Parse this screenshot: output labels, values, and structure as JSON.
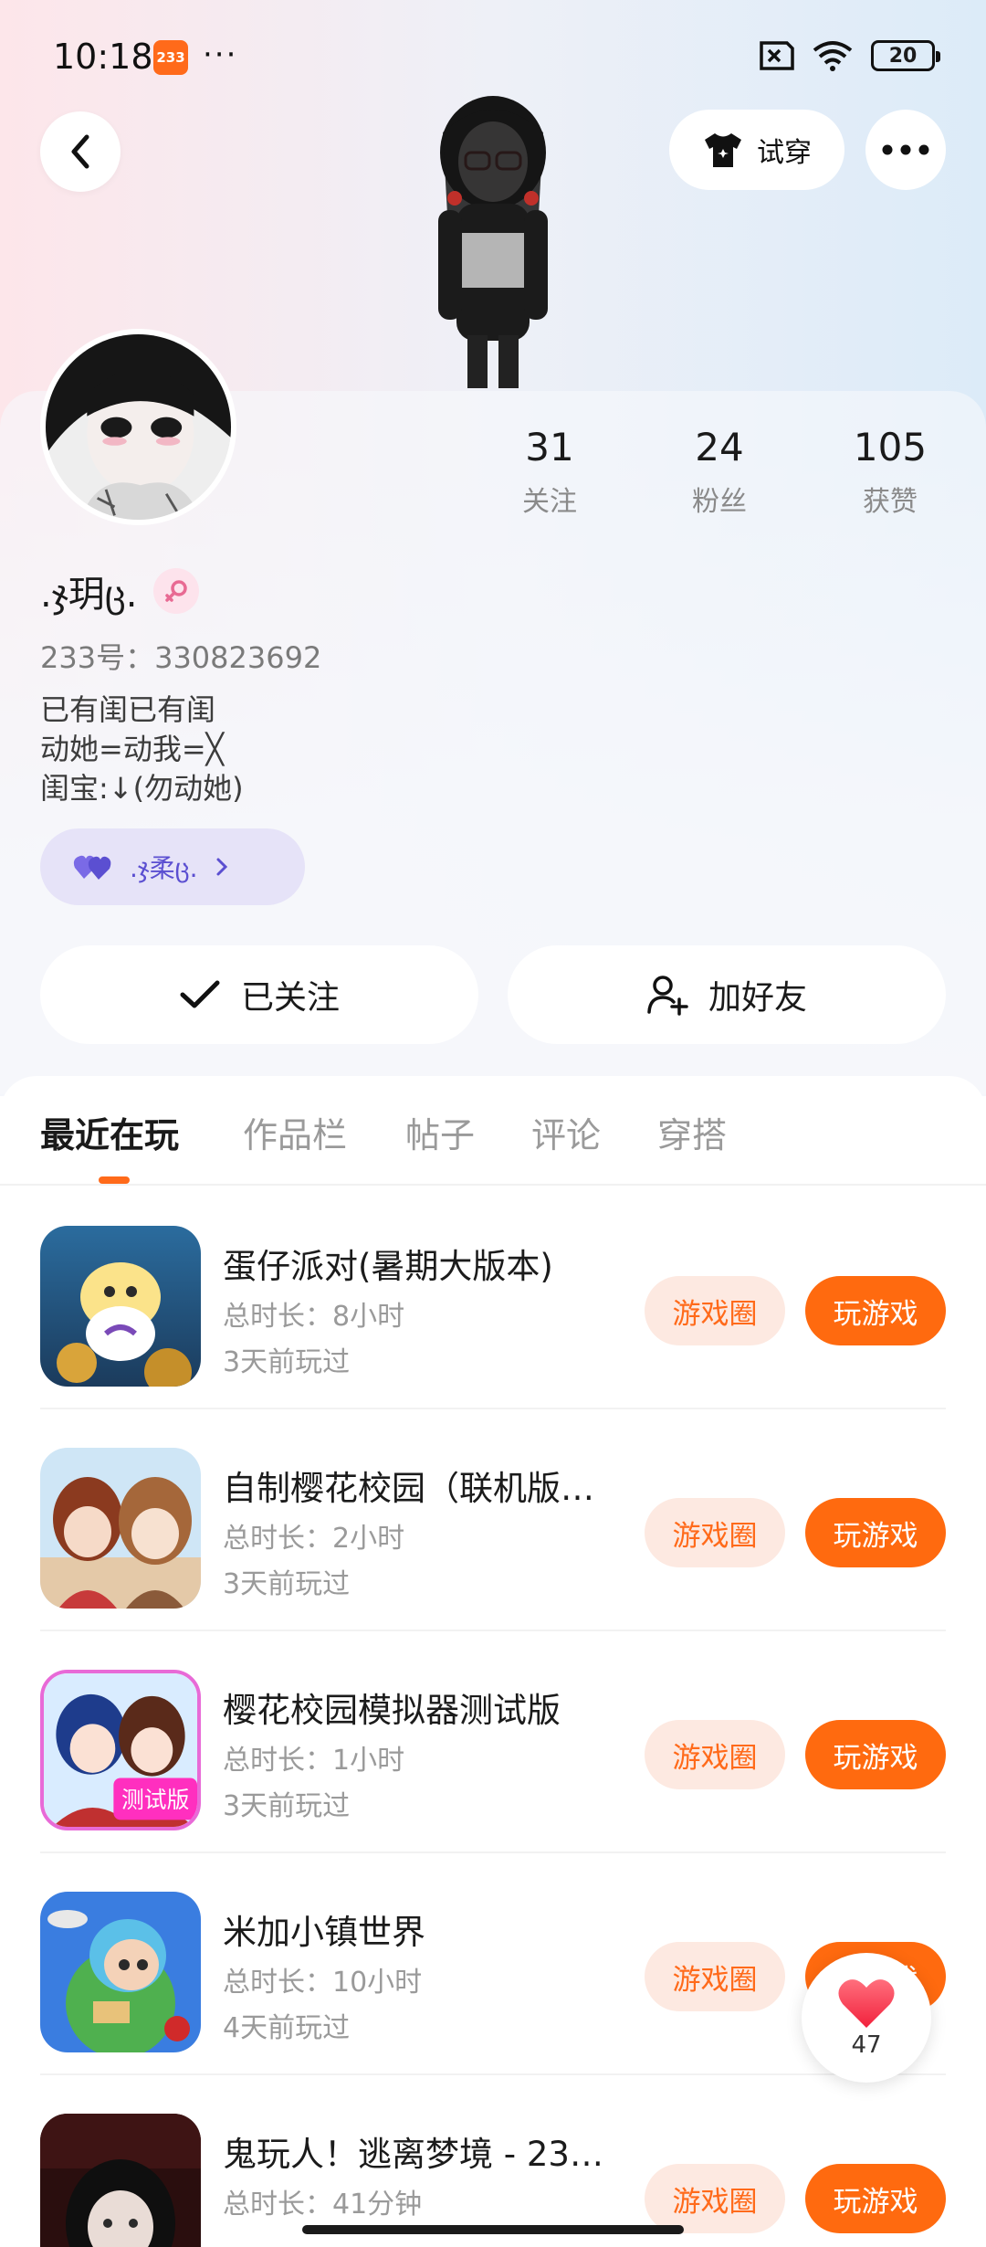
{
  "status_bar": {
    "time": "10:18",
    "app_badge": "233",
    "dots": "···",
    "battery": "20"
  },
  "header": {
    "tryon_label": "试穿"
  },
  "profile": {
    "stats": [
      {
        "value": "31",
        "label": "关注"
      },
      {
        "value": "24",
        "label": "粉丝"
      },
      {
        "value": "105",
        "label": "获赞"
      }
    ],
    "nickname": ".ჯ玥ც.",
    "user_id": "233号：330823692",
    "bio_lines": [
      "已有闺已有闺",
      "动她=动我=╳",
      "闺宝:↓(勿动她)"
    ],
    "relation_label": ".ჯ柔ც."
  },
  "actions": {
    "followed_label": "已关注",
    "add_friend_label": "加好友"
  },
  "tabs": [
    "最近在玩",
    "作品栏",
    "帖子",
    "评论",
    "穿搭"
  ],
  "games": [
    {
      "title": "蛋仔派对(暑期大版本)",
      "playtime": "总时长：8小时",
      "last_played": "3天前玩过",
      "circle_label": "游戏圈",
      "play_label": "玩游戏"
    },
    {
      "title": "自制樱花校园（联机版…",
      "playtime": "总时长：2小时",
      "last_played": "3天前玩过",
      "circle_label": "游戏圈",
      "play_label": "玩游戏"
    },
    {
      "title": "樱花校园模拟器测试版",
      "playtime": "总时长：1小时",
      "last_played": "3天前玩过",
      "circle_label": "游戏圈",
      "play_label": "玩游戏"
    },
    {
      "title": "米加小镇世界",
      "playtime": "总时长：10小时",
      "last_played": "4天前玩过",
      "circle_label": "游戏圈",
      "play_label": "玩游戏"
    },
    {
      "title": "鬼玩人！逃离梦境 - 23…",
      "playtime": "总时长：41分钟",
      "last_played": "",
      "circle_label": "游戏圈",
      "play_label": "玩游戏"
    }
  ],
  "like_float": {
    "count": "47"
  },
  "colors": {
    "accent": "#ff6a0f",
    "accent_soft": "#fde9e1",
    "chip_bg": "#e6e3f8",
    "chip_text": "#5b4fd1"
  }
}
